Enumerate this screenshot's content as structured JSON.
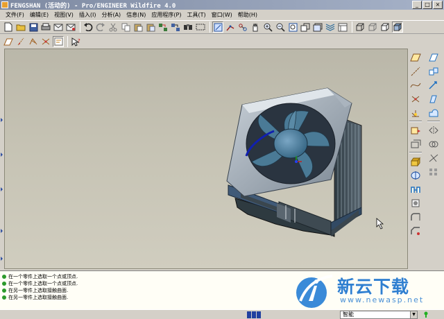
{
  "window": {
    "title": "FENGSHAN (活动的) - Pro/ENGINEER Wildfire 4.0",
    "controls": [
      "_",
      "□",
      "×"
    ]
  },
  "menu": [
    {
      "label": "文件(F)"
    },
    {
      "label": "编辑(E)"
    },
    {
      "label": "视图(V)"
    },
    {
      "label": "插入(I)"
    },
    {
      "label": "分析(A)"
    },
    {
      "label": "信息(N)"
    },
    {
      "label": "应用程序(P)"
    },
    {
      "label": "工具(T)"
    },
    {
      "label": "窗口(W)"
    },
    {
      "label": "帮助(H)"
    }
  ],
  "messages": [
    "在一个零件上选取一个点或顶点.",
    "在一个零件上选取一个点或顶点.",
    "在另一零件上选取接触曲面.",
    "在另一零件上选取接触曲面."
  ],
  "status": {
    "filter_value": "智能"
  },
  "watermark": {
    "text": "新云下载",
    "url": "www.newasp.net"
  },
  "colors": {
    "fan_blade": "#4a7a96",
    "heatsink": "#3e4a52",
    "base": "#405a78",
    "viewport_bg": "#c4c1b2"
  }
}
